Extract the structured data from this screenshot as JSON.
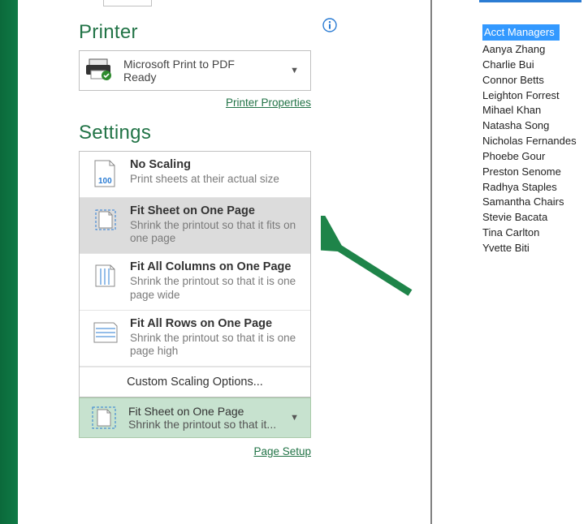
{
  "printer": {
    "section_title": "Printer",
    "name": "Microsoft Print to PDF",
    "status": "Ready",
    "properties_link": "Printer Properties"
  },
  "settings": {
    "section_title": "Settings",
    "options": [
      {
        "title": "No Scaling",
        "desc": "Print sheets at their actual size"
      },
      {
        "title": "Fit Sheet on One Page",
        "desc": "Shrink the printout so that it fits on one page"
      },
      {
        "title": "Fit All Columns on One Page",
        "desc": "Shrink the printout so that it is one page wide"
      },
      {
        "title": "Fit All Rows on One Page",
        "desc": "Shrink the printout so that it is one page high"
      }
    ],
    "custom_label": "Custom Scaling Options...",
    "selected_title": "Fit Sheet on One Page",
    "selected_desc": "Shrink the printout so that it...",
    "page_setup_link": "Page Setup"
  },
  "preview": {
    "column_header": "Acct Managers",
    "names": [
      "Aanya Zhang",
      "Charlie Bui",
      "Connor Betts",
      "Leighton Forrest",
      "Mihael Khan",
      "Natasha Song",
      "Nicholas Fernandes",
      "Phoebe Gour",
      "Preston Senome",
      "Radhya Staples",
      "Samantha Chairs",
      "Stevie Bacata",
      "Tina Carlton",
      "Yvette Biti"
    ]
  },
  "icons": {
    "info": "info-icon",
    "printer": "printer-icon",
    "no_scaling": "page-100-icon",
    "fit_page": "fit-page-icon",
    "fit_cols": "fit-columns-icon",
    "fit_rows": "fit-rows-icon"
  },
  "colors": {
    "accent": "#217346",
    "hover": "#dcdcdc",
    "selected_bg": "#c7e2cf"
  }
}
